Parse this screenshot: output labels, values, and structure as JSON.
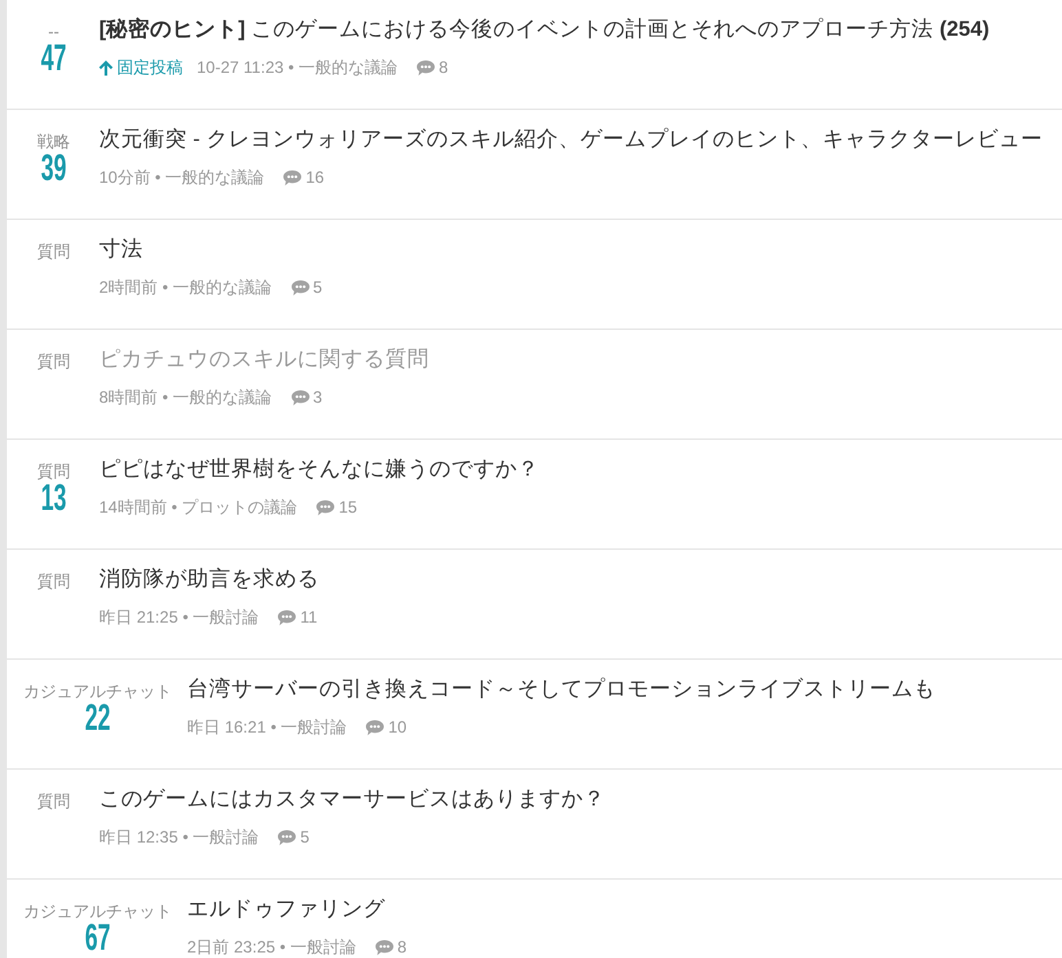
{
  "pinned_label": "固定投稿",
  "topics": [
    {
      "category": "--",
      "score": "47",
      "title": "**[秘密のヒント]** このゲームにおける今後のイベントの計画とそれへのアプローチ方法 **(254)**",
      "pinned": true,
      "visited": false,
      "meta": "10-27 11:23 • 一般的な議論",
      "comments": "8"
    },
    {
      "category": "戦略",
      "score": "39",
      "title": "次元衝突 - クレヨンウォリアーズのスキル紹介、ゲームプレイのヒント、キャラクターレビュー",
      "pinned": false,
      "visited": false,
      "meta": "10分前 • 一般的な議論",
      "comments": "16"
    },
    {
      "category": "質問",
      "title": "寸法",
      "pinned": false,
      "visited": false,
      "meta": "2時間前 • 一般的な議論",
      "comments": "5"
    },
    {
      "category": "質問",
      "title": "ピカチュウのスキルに関する質問",
      "pinned": false,
      "visited": true,
      "meta": "8時間前 • 一般的な議論",
      "comments": "3"
    },
    {
      "category": "質問",
      "score": "13",
      "title": "ピピはなぜ世界樹をそんなに嫌うのですか？",
      "pinned": false,
      "visited": false,
      "meta": "14時間前 • プロットの議論",
      "comments": "15"
    },
    {
      "category": "質問",
      "title": "消防隊が助言を求める",
      "pinned": false,
      "visited": false,
      "meta": "昨日 21:25 • 一般討論",
      "comments": "11"
    },
    {
      "category": "カジュアルチャット",
      "score": "22",
      "title": "台湾サーバーの引き換えコード～そしてプロモーションライブストリームも",
      "pinned": false,
      "visited": false,
      "meta": "昨日 16:21 • 一般討論",
      "comments": "10"
    },
    {
      "category": "質問",
      "title": "このゲームにはカスタマーサービスはありますか？",
      "pinned": false,
      "visited": false,
      "meta": "昨日 12:35 • 一般討論",
      "comments": "5"
    },
    {
      "category": "カジュアルチャット",
      "score": "67",
      "title": "エルドゥファリング",
      "pinned": false,
      "visited": false,
      "meta": "2日前 23:25 • 一般討論",
      "comments": "8"
    }
  ]
}
